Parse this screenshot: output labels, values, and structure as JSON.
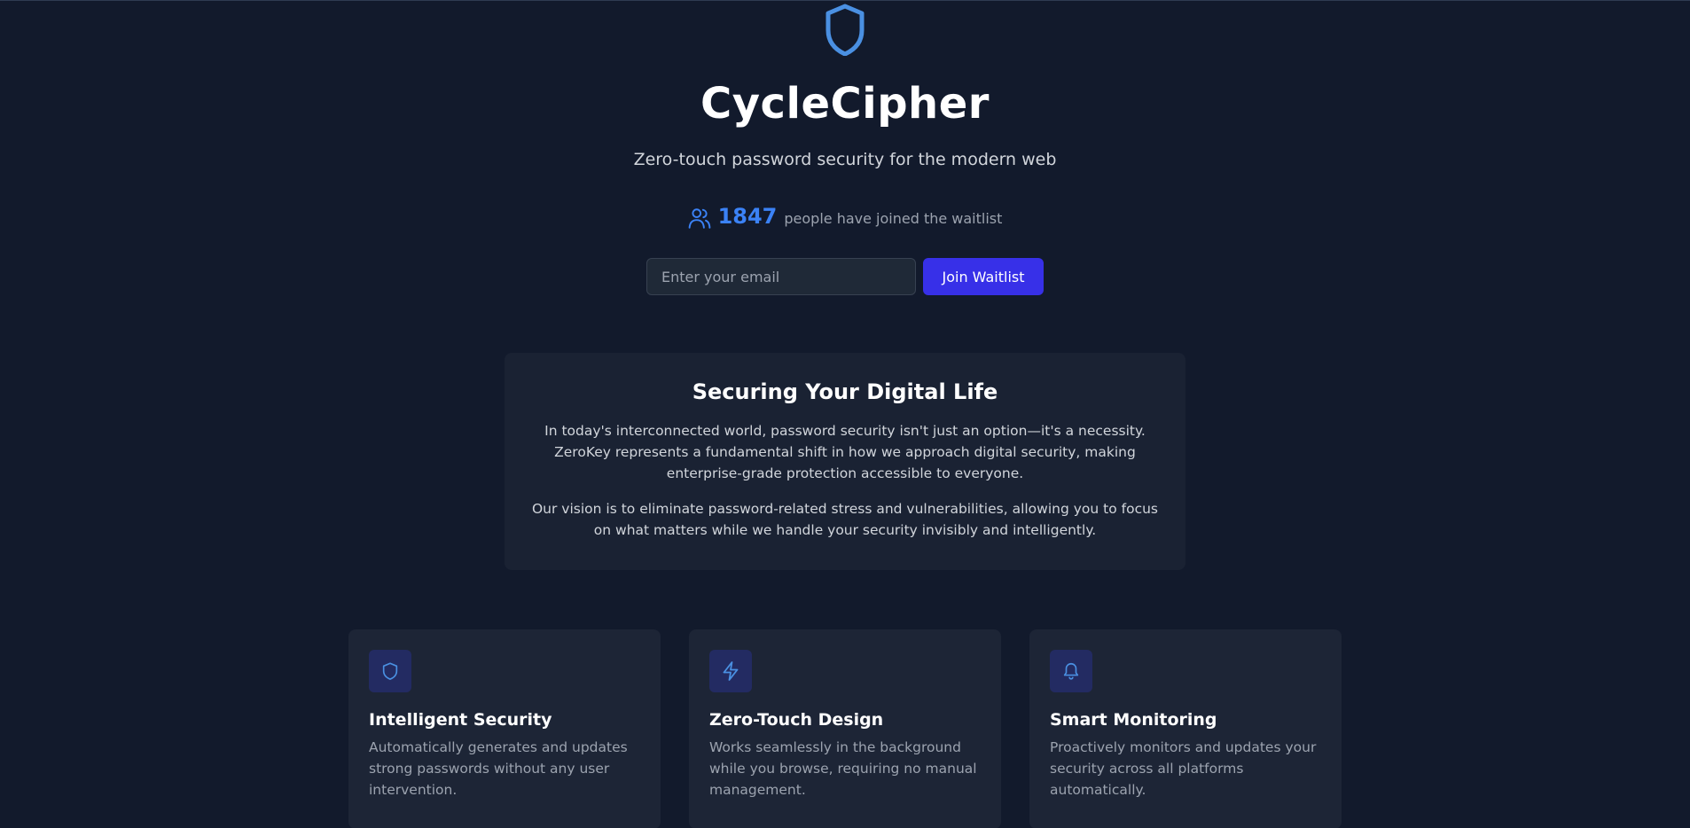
{
  "hero": {
    "logo_icon": "shield-icon",
    "title": "CycleCipher",
    "subtitle": "Zero-touch password security for the modern web",
    "waitlist": {
      "icon": "users-icon",
      "count": "1847",
      "text": "people have joined the waitlist"
    }
  },
  "signup": {
    "email_placeholder": "Enter your email",
    "email_value": "",
    "button_label": "Join Waitlist"
  },
  "mission": {
    "heading": "Securing Your Digital Life",
    "paragraphs": [
      "In today's interconnected world, password security isn't just an option—it's a necessity. ZeroKey represents a fundamental shift in how we approach digital security, making enterprise-grade protection accessible to everyone.",
      "Our vision is to eliminate password-related stress and vulnerabilities, allowing you to focus on what matters while we handle your security invisibly and intelligently."
    ]
  },
  "features": [
    {
      "icon": "shield-icon",
      "title": "Intelligent Security",
      "description": "Automatically generates and updates strong passwords without any user intervention."
    },
    {
      "icon": "lightning-icon",
      "title": "Zero-Touch Design",
      "description": "Works seamlessly in the background while you browse, requiring no manual management."
    },
    {
      "icon": "bell-icon",
      "title": "Smart Monitoring",
      "description": "Proactively monitors and updates your security across all platforms automatically."
    }
  ],
  "colors": {
    "background": "#121a2c",
    "card": "#1d2536",
    "accent": "#3b82f6",
    "button": "#3730e8"
  }
}
